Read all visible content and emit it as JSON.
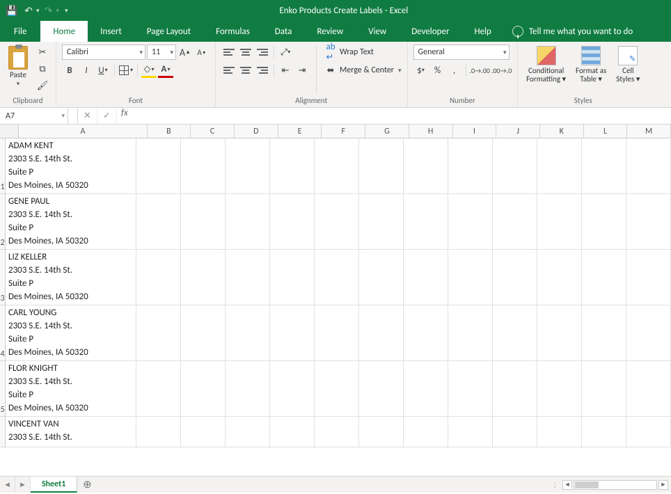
{
  "title": "Enko Products Create Labels  -  Excel",
  "tabs": {
    "file": "File",
    "home": "Home",
    "insert": "Insert",
    "pagelayout": "Page Layout",
    "formulas": "Formulas",
    "data": "Data",
    "review": "Review",
    "view": "View",
    "developer": "Developer",
    "help": "Help"
  },
  "tellme": "Tell me what you want to do",
  "font": {
    "name": "Calibri",
    "size": "11"
  },
  "number_format": "General",
  "groups": {
    "clipboard": "Clipboard",
    "font": "Font",
    "alignment": "Alignment",
    "number": "Number",
    "styles": "Styles"
  },
  "buttons": {
    "paste": "Paste",
    "wrap": "Wrap Text",
    "merge": "Merge & Center",
    "cond": "Conditional",
    "cond2": "Formatting",
    "fmtas": "Format as",
    "fmtas2": "Table",
    "cellst": "Cell",
    "cellst2": "Styles"
  },
  "namebox": "A7",
  "columns": [
    "A",
    "B",
    "C",
    "D",
    "E",
    "F",
    "G",
    "H",
    "I",
    "J",
    "K",
    "L",
    "M"
  ],
  "rows": [
    {
      "n": "1",
      "a": "ADAM KENT\n2303 S.E. 14th St.\nSuite P\nDes Moines, IA 50320"
    },
    {
      "n": "2",
      "a": "GENE PAUL\n2303 S.E. 14th St.\nSuite P\nDes Moines, IA 50320"
    },
    {
      "n": "3",
      "a": "LIZ KELLER\n2303 S.E. 14th St.\nSuite P\nDes Moines, IA 50320"
    },
    {
      "n": "4",
      "a": "CARL YOUNG\n2303 S.E. 14th St.\nSuite P\nDes Moines, IA 50320"
    },
    {
      "n": "5",
      "a": "FLOR KNIGHT\n2303 S.E. 14th St.\nSuite P\nDes Moines, IA 50320"
    },
    {
      "n": "",
      "a": "VINCENT VAN\n2303 S.E. 14th St."
    }
  ],
  "sheet": "Sheet1",
  "percent": "%",
  "comma": ",",
  "currency": "$"
}
